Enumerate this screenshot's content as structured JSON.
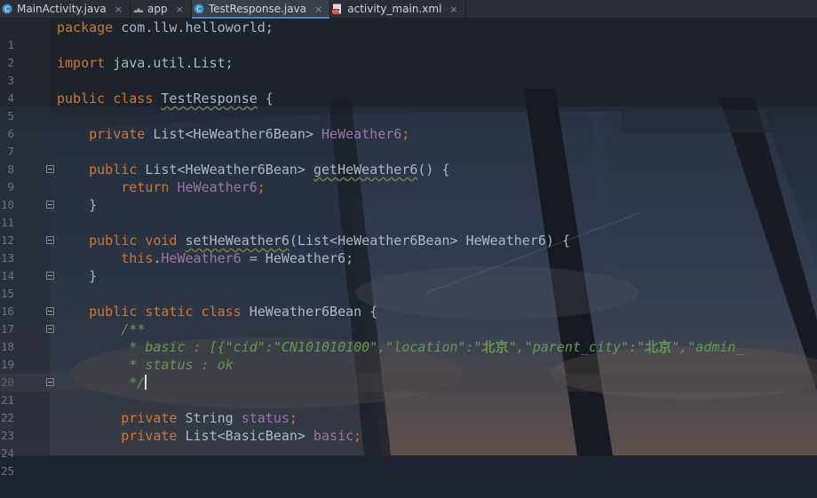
{
  "tabs": [
    {
      "label": "MainActivity.java",
      "icon": "java-class-icon",
      "active": false
    },
    {
      "label": "app",
      "icon": "android-module-icon",
      "active": false
    },
    {
      "label": "TestResponse.java",
      "icon": "java-class-icon",
      "active": true
    },
    {
      "label": "activity_main.xml",
      "icon": "xml-layout-icon",
      "active": false
    }
  ],
  "close_glyph": "×",
  "colors": {
    "keyword": "#cc7832",
    "field": "#9876aa",
    "comment": "#629755",
    "text": "#a9b7c6",
    "accent": "#4a88c7"
  },
  "lines": {
    "l1": {
      "num": "1",
      "kw": "package",
      "rest": " com.llw.helloworld;"
    },
    "l2": {
      "num": "2"
    },
    "l3": {
      "num": "3",
      "kw": "import",
      "rest": " java.util.List;"
    },
    "l4": {
      "num": "4"
    },
    "l5": {
      "num": "5",
      "kw": "public class",
      "name": "TestResponse",
      "rest": " {"
    },
    "l6": {
      "num": "6"
    },
    "l7": {
      "num": "7",
      "kw": "private",
      "type": " List<HeWeather6Bean> ",
      "field": "HeWeather6",
      "end": ";"
    },
    "l8": {
      "num": "8"
    },
    "l9": {
      "num": "9",
      "kw": "public",
      "type": " List<HeWeather6Bean> ",
      "name": "getHeWeather6",
      "end": "() {"
    },
    "l10": {
      "num": "10",
      "kw": "return",
      "field": "HeWeather6",
      "end": ";"
    },
    "l11": {
      "num": "11",
      "text": "}"
    },
    "l12": {
      "num": "12"
    },
    "l13": {
      "num": "13",
      "kw": "public void",
      "name": "setHeWeather6",
      "end": "(List<HeWeather6Bean> HeWeather6) {"
    },
    "l14": {
      "num": "14",
      "kw": "this",
      "dot": ".",
      "field": "HeWeather6",
      "end": " = HeWeather6;"
    },
    "l15": {
      "num": "15",
      "text": "}"
    },
    "l16": {
      "num": "16"
    },
    "l17": {
      "num": "17",
      "kw": "public static class",
      "rest": " HeWeather6Bean {"
    },
    "l18": {
      "num": "18",
      "text": "/**"
    },
    "l19": {
      "num": "19",
      "p1": " * basic : [{\"cid\":\"CN101010100\",\"location\":\"",
      "h1": "北京",
      "p2": "\",\"parent_city\":\"",
      "h2": "北京",
      "p3": "\",\"admin_"
    },
    "l20": {
      "num": "20",
      "text": " * status : ok"
    },
    "l21": {
      "num": "21",
      "text": " */"
    },
    "l22": {
      "num": "22"
    },
    "l23": {
      "num": "23",
      "kw": "private",
      "type": " String ",
      "field": "status",
      "end": ";"
    },
    "l24": {
      "num": "24",
      "kw": "private",
      "type": " List<BasicBean> ",
      "field": "basic",
      "end": ";"
    },
    "l25": {
      "num": "25"
    }
  }
}
